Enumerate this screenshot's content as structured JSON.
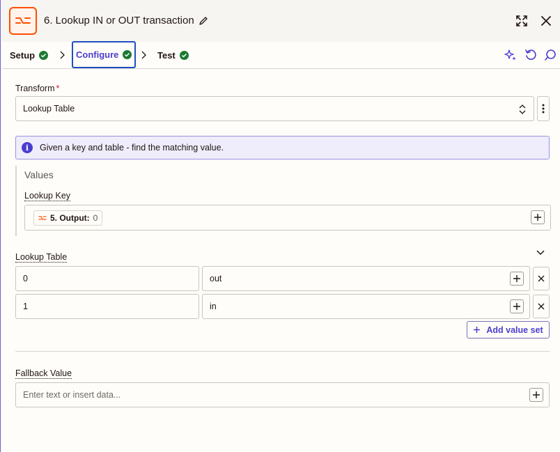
{
  "header": {
    "title": "6. Lookup IN or OUT transaction",
    "icons": [
      "formatter-app-icon",
      "pencil-icon",
      "expand-icon",
      "close-icon"
    ]
  },
  "tabs": [
    {
      "label": "Setup",
      "status": "complete"
    },
    {
      "label": "Configure",
      "status": "complete",
      "active": true
    },
    {
      "label": "Test",
      "status": "complete"
    }
  ],
  "toolbar_icons": [
    "sparkle-icon",
    "undo-icon",
    "comment-icon"
  ],
  "transform": {
    "label": "Transform",
    "required_mark": "*",
    "value": "Lookup Table"
  },
  "info": {
    "text": "Given a key and table - find the matching value."
  },
  "values": {
    "heading": "Values",
    "lookup_key": {
      "label": "Lookup Key",
      "pill_label": "5. Output:",
      "pill_value": "0"
    }
  },
  "lookup_table": {
    "label": "Lookup Table",
    "rows": [
      {
        "key": "0",
        "value": "out"
      },
      {
        "key": "1",
        "value": "in"
      }
    ],
    "add_label": "Add value set"
  },
  "fallback": {
    "label": "Fallback Value",
    "placeholder": "Enter text or insert data..."
  },
  "colors": {
    "accent": "#4a3ed0",
    "brand": "#ff4f00",
    "success": "#1b7a32"
  }
}
